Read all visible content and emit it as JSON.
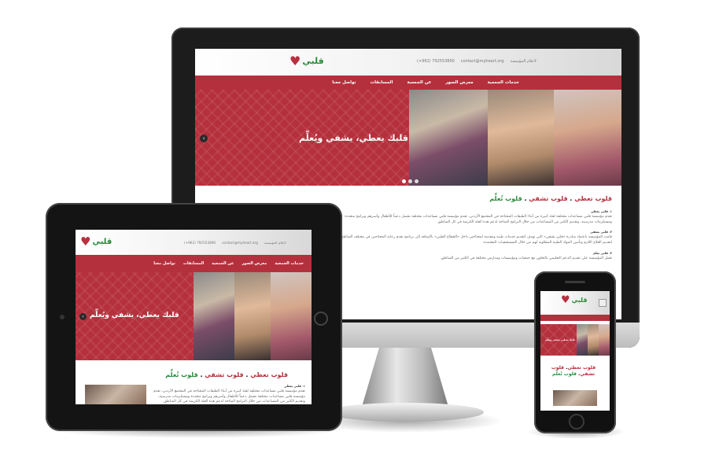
{
  "site": {
    "logo_text": "قلبي",
    "contact_email": "contact@myheart.org",
    "contact_phone": "(+962) 792553890",
    "contact_label": "لاعلام المؤسسة",
    "nav": [
      "خدمات الجمعية",
      "معرض الصور",
      "عن الجمعية",
      "المسابقات",
      "تواصل معنا"
    ],
    "hero_tagline": "قلبك يعطي، يشفي ويُعلِّم",
    "section_title_parts": [
      "قلوب تعطي",
      "قلوب تشفي",
      "قلوب تُعلِّم"
    ],
    "paragraphs": [
      {
        "heading": "١. قلبي يعطي",
        "text": "تقدم مؤسسة قلبي مساعدات مختلفة لفئة كبيرة من أبناء الطبقات المحتاجة في المجتمع الأردني، تقدم مؤسسة قلبي مساعدات مختلفة تشمل دعماً للأطفال وأسرهم وبرامج متعددة ومستلزمات مدرسية، وتقديم الكثير من المساعدات من خلال البرامج المتاحة لدعم هذه الفئة الكريمة في كل المناطق."
      },
      {
        "heading": "٢. قلبي يشفي",
        "text": "قامت المؤسسة باعتماد مبادرة «قلبي يشفي» التي تهدف لتقديم خدمات طبية ومقدمة لمحتاجين داخل «القطاع الطبي» بالإضافة إلى برنامج يقدم رعاية المحتاجين في مختلف المناطق لتقديم العلاج اللازم وتأمين المواد الطبية المطلوبة لهم من خلال المستشفيات المعتمدة."
      },
      {
        "heading": "٣. قلبي يعلم",
        "text": "تعمل المؤسسة على تقديم الدعم التعليمي بالتعاون مع جمعيات ومؤسسات ومدارس مختلفة في الكثير من المناطق."
      }
    ],
    "slider_dots": 3,
    "slider_active": 0
  },
  "colors": {
    "primary_red": "#b5303d",
    "accent_green": "#2a8a3a"
  }
}
